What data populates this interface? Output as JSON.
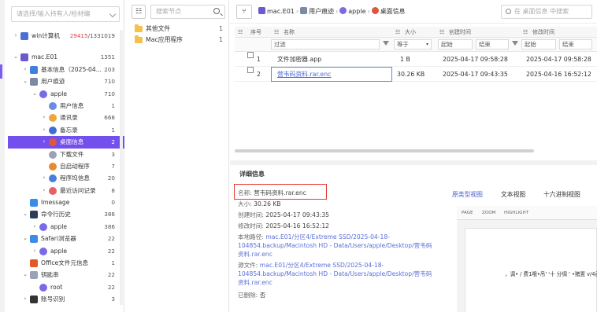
{
  "left_panel": {
    "case_select_placeholder": "请选择/输入持有人/检材编",
    "tree": [
      {
        "label": "win计算机",
        "count_red": "29415",
        "count": "/1331019",
        "level": 0,
        "arrow": "›",
        "icon_color": "#4a6fd6",
        "icon": "computer-icon"
      },
      {
        "label": "mac.E01",
        "count": "1351",
        "level": 0,
        "arrow": "⌄",
        "icon_color": "#6a5acd",
        "icon": "disk-icon"
      },
      {
        "label": "基本信息（2025-04...",
        "count": "203",
        "level": 1,
        "arrow": "›",
        "icon_color": "#3f7fe0",
        "icon": "info-icon"
      },
      {
        "label": "用户痕迹",
        "count": "710",
        "level": 1,
        "arrow": "⌄",
        "icon_color": "#7d8aa3",
        "icon": "users-icon"
      },
      {
        "label": "apple",
        "count": "710",
        "level": 2,
        "arrow": "⌄",
        "icon_color": "#7a6ae6",
        "icon": "user-icon"
      },
      {
        "label": "用户信息",
        "count": "1",
        "level": 3,
        "arrow": "",
        "icon_color": "#6a8ce6",
        "icon": "user-info-icon"
      },
      {
        "label": "通讯录",
        "count": "668",
        "level": 3,
        "arrow": "›",
        "icon_color": "#f2a63a",
        "icon": "contacts-icon"
      },
      {
        "label": "备忘录",
        "count": "1",
        "level": 3,
        "arrow": "›",
        "icon_color": "#3d6fd8",
        "icon": "notes-icon"
      },
      {
        "label": "桌面信息",
        "count": "2",
        "level": 3,
        "arrow": "›",
        "icon_color": "#e0563c",
        "icon": "desktop-icon",
        "selected": true
      },
      {
        "label": "下载文件",
        "count": "3",
        "level": 3,
        "arrow": "",
        "icon_color": "#9aa3b5",
        "icon": "download-icon"
      },
      {
        "label": "自启动程序",
        "count": "7",
        "level": 3,
        "arrow": "",
        "icon_color": "#ea8a2e",
        "icon": "autostart-icon"
      },
      {
        "label": "程序坞信息",
        "count": "20",
        "level": 3,
        "arrow": "›",
        "icon_color": "#4a7fe0",
        "icon": "dock-icon"
      },
      {
        "label": "最近访问记录",
        "count": "8",
        "level": 3,
        "arrow": "›",
        "icon_color": "#e86060",
        "icon": "recent-icon"
      },
      {
        "label": "Imessage",
        "count": "0",
        "level": 1,
        "arrow": "",
        "icon_color": "#3a8ce6",
        "icon": "message-icon"
      },
      {
        "label": "命令行历史",
        "count": "386",
        "level": 1,
        "arrow": "⌄",
        "icon_color": "#2e3e57",
        "icon": "terminal-icon"
      },
      {
        "label": "apple",
        "count": "386",
        "level": 2,
        "arrow": "›",
        "icon_color": "#7a6ae6",
        "icon": "user-icon"
      },
      {
        "label": "Safari浏览器",
        "count": "22",
        "level": 1,
        "arrow": "⌄",
        "icon_color": "#3a8ce6",
        "icon": "safari-icon"
      },
      {
        "label": "apple",
        "count": "22",
        "level": 2,
        "arrow": "›",
        "icon_color": "#7a6ae6",
        "icon": "user-icon"
      },
      {
        "label": "Office文件元信息",
        "count": "1",
        "level": 1,
        "arrow": "",
        "icon_color": "#e05a2a",
        "icon": "office-icon"
      },
      {
        "label": "钥匙串",
        "count": "22",
        "level": 1,
        "arrow": "⌄",
        "icon_color": "#9aa3b5",
        "icon": "keychain-icon"
      },
      {
        "label": "root",
        "count": "22",
        "level": 2,
        "arrow": "",
        "icon_color": "#7a6ae6",
        "icon": "user-icon"
      },
      {
        "label": "账号识别",
        "count": "3",
        "level": 1,
        "arrow": "›",
        "icon_color": "#333333",
        "icon": "account-icon"
      }
    ]
  },
  "node_panel": {
    "search_placeholder": "搜索节点",
    "nodes": [
      {
        "label": "其他文件",
        "count": "1"
      },
      {
        "label": "Mac应用程序",
        "count": "1"
      }
    ]
  },
  "breadcrumb": {
    "items": [
      "mac.E01",
      "用户痕迹",
      "apple",
      "桌面信息"
    ],
    "search_placeholder": "在 桌面信息 中搜索"
  },
  "table": {
    "headers": {
      "index": "序号",
      "name": "名称",
      "size": "大小",
      "created": "创建时间",
      "modified": "修改时间"
    },
    "filter": {
      "name": "过滤",
      "size_op": "等于",
      "created_start": "起始",
      "created_end": "结束",
      "modified_start": "起始",
      "modified_end": "结束"
    },
    "rows": [
      {
        "index": "1",
        "name": "文件加密器.app",
        "size": "1 B",
        "created": "2025-04-17 09:58:28",
        "modified": "2025-04-17 09:58:28"
      },
      {
        "index": "2",
        "name": "营韦码资料.rar.enc",
        "size": "30.26 KB",
        "created": "2025-04-17 09:43:35",
        "modified": "2025-04-16 16:52:12"
      }
    ]
  },
  "details": {
    "title": "详细信息",
    "name_label": "名称:",
    "name_value": "营韦码资料.rar.enc",
    "size_label": "大小:",
    "size_value": "30.26 KB",
    "created_label": "创建时间:",
    "created_value": "2025-04-17 09:43:35",
    "modified_label": "修改时间:",
    "modified_value": "2025-04-16 16:52:12",
    "local_path_label": "本地路径:",
    "local_path_1": "mac.E01/分区4/Extreme SSD/2025-04-18-",
    "local_path_2": "104854.backup/Macintosh HD - Data/Users/apple/Desktop/营韦码",
    "local_path_3": "资料.rar.enc",
    "source_label": "源文件:",
    "source_1": "mac.E01/分区4/Extreme SSD/2025-04-18-",
    "source_2": "104854.backup/Macintosh HD - Data/Users/apple/Desktop/营韦码",
    "source_3": "资料.rar.enc",
    "deleted_label": "已删除:",
    "deleted_value": "否"
  },
  "viewer": {
    "tabs": [
      "原类型视图",
      "文本视图",
      "十六进制视图"
    ],
    "tools": [
      "PAGE",
      "ZOOM",
      "HIGHLIGHT"
    ],
    "preview_text": "，调• / 费1哦•吊' '十 分绸 ' •猪置 v/4函"
  }
}
